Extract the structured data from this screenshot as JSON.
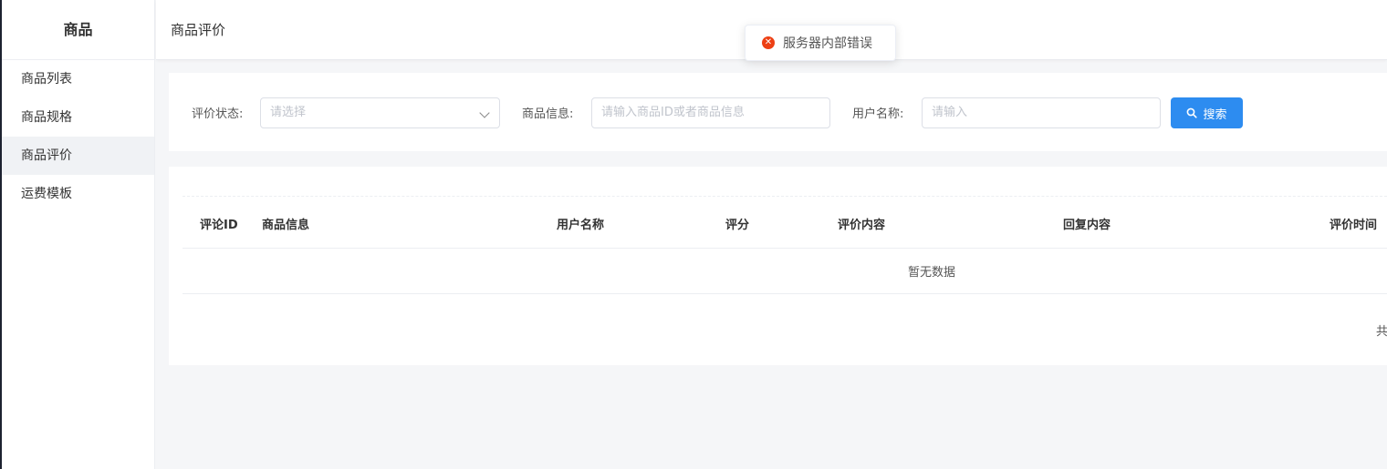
{
  "sidebar": {
    "title": "商品",
    "items": [
      {
        "label": "商品列表",
        "active": false
      },
      {
        "label": "商品规格",
        "active": false
      },
      {
        "label": "商品评价",
        "active": true
      },
      {
        "label": "运费模板",
        "active": false
      }
    ]
  },
  "header": {
    "title": "商品评价"
  },
  "filters": {
    "status_label": "评价状态:",
    "status_placeholder": "请选择",
    "product_label": "商品信息:",
    "product_placeholder": "请输入商品ID或者商品信息",
    "user_label": "用户名称:",
    "user_placeholder": "请输入",
    "search_label": "搜索"
  },
  "table": {
    "columns": [
      "评论ID",
      "商品信息",
      "用户名称",
      "评分",
      "评价内容",
      "回复内容",
      "评价时间"
    ],
    "empty_text": "暂无数据",
    "total_text": "共"
  },
  "toast": {
    "message": "服务器内部错误",
    "icon": "error-circle-icon"
  },
  "colors": {
    "primary": "#2d8cf0",
    "error": "#ed4014"
  }
}
